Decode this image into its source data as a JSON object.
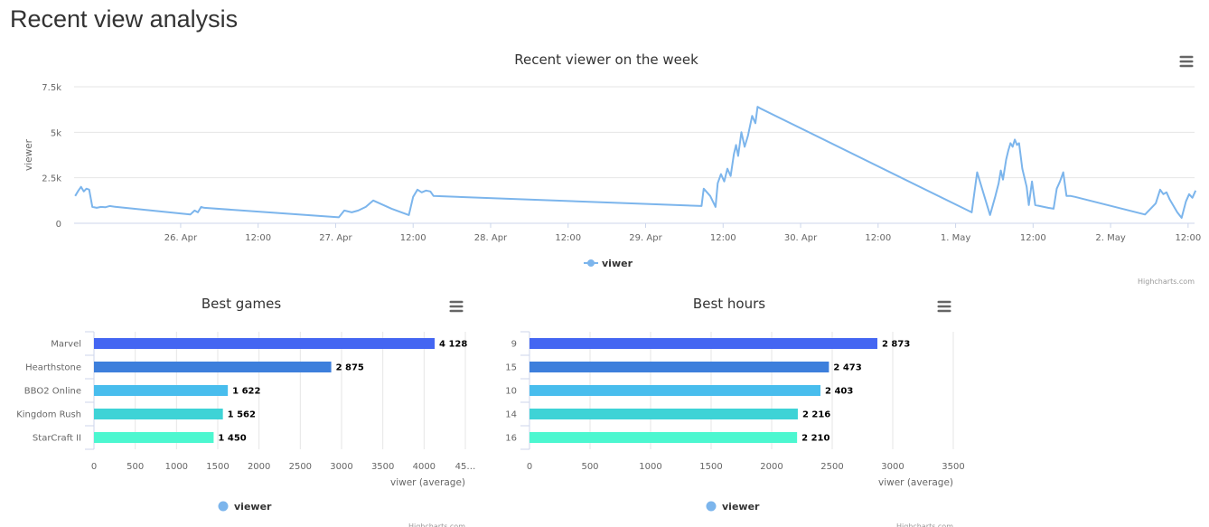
{
  "page": {
    "title": "Recent view analysis"
  },
  "colors": {
    "line": "#7cb5ec",
    "bars": [
      "#4466f2",
      "#3d7fdc",
      "#48bded",
      "#3ed3d6",
      "#4cf7d0"
    ],
    "legend_dot": "#7cb5ec",
    "grid": "#e6e6e6"
  },
  "icons": {
    "menu": "hamburger-menu-icon"
  },
  "chart_data": [
    {
      "type": "line",
      "title": "Recent viewer on the week",
      "ylabel": "viewer",
      "ylim": [
        0,
        7500
      ],
      "y_ticks": [
        "0",
        "2.5k",
        "5k",
        "7.5k"
      ],
      "y_tick_values": [
        0,
        2500,
        5000,
        7500
      ],
      "x_range": [
        "2023-04-25T07:30",
        "2023-05-02T13:00"
      ],
      "x_ticks": [
        {
          "t": "2023-04-26T00:00",
          "label": "26. Apr"
        },
        {
          "t": "2023-04-26T12:00",
          "label": "12:00"
        },
        {
          "t": "2023-04-27T00:00",
          "label": "27. Apr"
        },
        {
          "t": "2023-04-27T12:00",
          "label": "12:00"
        },
        {
          "t": "2023-04-28T00:00",
          "label": "28. Apr"
        },
        {
          "t": "2023-04-28T12:00",
          "label": "12:00"
        },
        {
          "t": "2023-04-29T00:00",
          "label": "29. Apr"
        },
        {
          "t": "2023-04-29T12:00",
          "label": "12:00"
        },
        {
          "t": "2023-04-30T00:00",
          "label": "30. Apr"
        },
        {
          "t": "2023-04-30T12:00",
          "label": "12:00"
        },
        {
          "t": "2023-05-01T00:00",
          "label": "1. May"
        },
        {
          "t": "2023-05-01T12:00",
          "label": "12:00"
        },
        {
          "t": "2023-05-02T00:00",
          "label": "2. May"
        },
        {
          "t": "2023-05-02T12:00",
          "label": "12:00"
        }
      ],
      "legend": [
        "viwer"
      ],
      "credits": "Highcharts.com",
      "series": [
        {
          "name": "viwer",
          "points": [
            [
              "2023-04-25T07:40",
              1500
            ],
            [
              "2023-04-25T08:10",
              1800
            ],
            [
              "2023-04-25T08:35",
              2000
            ],
            [
              "2023-04-25T09:00",
              1750
            ],
            [
              "2023-04-25T09:25",
              1900
            ],
            [
              "2023-04-25T09:50",
              1850
            ],
            [
              "2023-04-25T10:20",
              900
            ],
            [
              "2023-04-25T11:00",
              850
            ],
            [
              "2023-04-25T11:40",
              900
            ],
            [
              "2023-04-25T12:20",
              880
            ],
            [
              "2023-04-25T13:00",
              950
            ],
            [
              "2023-04-25T14:00",
              900
            ],
            [
              "2023-04-26T01:30",
              480
            ],
            [
              "2023-04-26T02:10",
              700
            ],
            [
              "2023-04-26T02:40",
              600
            ],
            [
              "2023-04-26T03:10",
              900
            ],
            [
              "2023-04-26T03:40",
              850
            ],
            [
              "2023-04-27T00:30",
              330
            ],
            [
              "2023-04-27T01:20",
              700
            ],
            [
              "2023-04-27T02:30",
              600
            ],
            [
              "2023-04-27T03:30",
              700
            ],
            [
              "2023-04-27T04:40",
              900
            ],
            [
              "2023-04-27T05:50",
              1250
            ],
            [
              "2023-04-27T08:40",
              800
            ],
            [
              "2023-04-27T11:20",
              450
            ],
            [
              "2023-04-27T12:00",
              1450
            ],
            [
              "2023-04-27T12:40",
              1850
            ],
            [
              "2023-04-27T13:20",
              1700
            ],
            [
              "2023-04-27T14:00",
              1800
            ],
            [
              "2023-04-27T14:40",
              1750
            ],
            [
              "2023-04-27T15:10",
              1500
            ],
            [
              "2023-04-29T08:40",
              950
            ],
            [
              "2023-04-29T09:00",
              1900
            ],
            [
              "2023-04-29T10:00",
              1500
            ],
            [
              "2023-04-29T10:50",
              900
            ],
            [
              "2023-04-29T11:10",
              2200
            ],
            [
              "2023-04-29T11:40",
              2700
            ],
            [
              "2023-04-29T12:10",
              2300
            ],
            [
              "2023-04-29T12:40",
              3000
            ],
            [
              "2023-04-29T13:10",
              2600
            ],
            [
              "2023-04-29T13:40",
              3800
            ],
            [
              "2023-04-29T14:00",
              4300
            ],
            [
              "2023-04-29T14:20",
              3700
            ],
            [
              "2023-04-29T14:50",
              5000
            ],
            [
              "2023-04-29T15:20",
              4200
            ],
            [
              "2023-04-29T15:50",
              4800
            ],
            [
              "2023-04-29T16:30",
              5900
            ],
            [
              "2023-04-29T17:00",
              5500
            ],
            [
              "2023-04-29T17:20",
              6400
            ],
            [
              "2023-04-29T17:50",
              6300
            ],
            [
              "2023-05-01T02:30",
              600
            ],
            [
              "2023-05-01T03:20",
              2800
            ],
            [
              "2023-05-01T05:20",
              450
            ],
            [
              "2023-05-01T06:10",
              1500
            ],
            [
              "2023-05-01T06:40",
              2200
            ],
            [
              "2023-05-01T07:00",
              2900
            ],
            [
              "2023-05-01T07:20",
              2400
            ],
            [
              "2023-05-01T07:50",
              3500
            ],
            [
              "2023-05-01T08:10",
              4000
            ],
            [
              "2023-05-01T08:30",
              4400
            ],
            [
              "2023-05-01T08:50",
              4200
            ],
            [
              "2023-05-01T09:10",
              4600
            ],
            [
              "2023-05-01T09:30",
              4300
            ],
            [
              "2023-05-01T09:50",
              4400
            ],
            [
              "2023-05-01T10:20",
              3000
            ],
            [
              "2023-05-01T11:00",
              2000
            ],
            [
              "2023-05-01T11:20",
              1000
            ],
            [
              "2023-05-01T11:50",
              2300
            ],
            [
              "2023-05-01T12:20",
              1000
            ],
            [
              "2023-05-01T13:00",
              950
            ],
            [
              "2023-05-01T13:40",
              900
            ],
            [
              "2023-05-01T14:20",
              850
            ],
            [
              "2023-05-01T15:10",
              800
            ],
            [
              "2023-05-01T15:40",
              1900
            ],
            [
              "2023-05-01T16:10",
              2300
            ],
            [
              "2023-05-01T16:40",
              2800
            ],
            [
              "2023-05-01T17:10",
              1500
            ],
            [
              "2023-05-01T17:50",
              1500
            ],
            [
              "2023-05-01T18:30",
              1450
            ],
            [
              "2023-05-02T05:20",
              480
            ],
            [
              "2023-05-02T07:00",
              1100
            ],
            [
              "2023-05-02T07:40",
              1850
            ],
            [
              "2023-05-02T08:10",
              1600
            ],
            [
              "2023-05-02T08:40",
              1700
            ],
            [
              "2023-05-02T09:10",
              1300
            ],
            [
              "2023-05-02T10:20",
              600
            ],
            [
              "2023-05-02T11:00",
              300
            ],
            [
              "2023-05-02T11:40",
              1200
            ],
            [
              "2023-05-02T12:10",
              1600
            ],
            [
              "2023-05-02T12:40",
              1400
            ],
            [
              "2023-05-02T13:10",
              1800
            ]
          ]
        }
      ]
    },
    {
      "type": "bar",
      "orientation": "horizontal",
      "title": "Best games",
      "categories": [
        "Marvel",
        "Hearthstone",
        "BBO2 Online",
        "Kingdom Rush",
        "StarCraft II"
      ],
      "values": [
        4128,
        2875,
        1622,
        1562,
        1450
      ],
      "value_labels": [
        "4 128",
        "2 875",
        "1 622",
        "1 562",
        "1 450"
      ],
      "xlim": [
        0,
        4500
      ],
      "x_ticks": [
        0,
        500,
        1000,
        1500,
        2000,
        2500,
        3000,
        3500,
        4000,
        4500
      ],
      "x_tick_labels": [
        "0",
        "500",
        "1000",
        "1500",
        "2000",
        "2500",
        "3000",
        "3500",
        "4000",
        "45…"
      ],
      "xlabel": "viwer (average)",
      "legend": [
        "viewer"
      ],
      "credits": "Highcharts.com"
    },
    {
      "type": "bar",
      "orientation": "horizontal",
      "title": "Best hours",
      "categories": [
        "9",
        "15",
        "10",
        "14",
        "16"
      ],
      "values": [
        2873,
        2473,
        2403,
        2216,
        2210
      ],
      "value_labels": [
        "2 873",
        "2 473",
        "2 403",
        "2 216",
        "2 210"
      ],
      "xlim": [
        0,
        3500
      ],
      "x_ticks": [
        0,
        500,
        1000,
        1500,
        2000,
        2500,
        3000,
        3500
      ],
      "x_tick_labels": [
        "0",
        "500",
        "1000",
        "1500",
        "2000",
        "2500",
        "3000",
        "3500"
      ],
      "xlabel": "viwer (average)",
      "legend": [
        "viewer"
      ],
      "credits": "Highcharts.com"
    }
  ]
}
